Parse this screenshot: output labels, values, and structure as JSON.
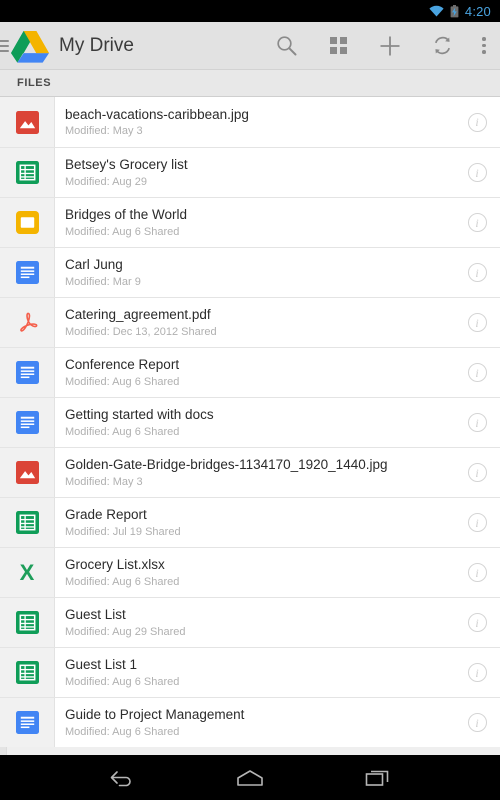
{
  "status_bar": {
    "time": "4:20",
    "wifi_icon": "wifi-icon",
    "battery_icon": "battery-charging-icon",
    "accent_color": "#4aa3df"
  },
  "action_bar": {
    "title": "My Drive",
    "menu_icon": "hamburger-menu-icon",
    "app_logo": "google-drive-logo",
    "actions": [
      {
        "name": "search-button",
        "icon": "search-icon"
      },
      {
        "name": "grid-view-button",
        "icon": "grid-view-icon"
      },
      {
        "name": "add-button",
        "icon": "plus-icon"
      },
      {
        "name": "sync-button",
        "icon": "sync-refresh-icon"
      },
      {
        "name": "overflow-menu-button",
        "icon": "more-vertical-icon"
      }
    ]
  },
  "tabs": [
    {
      "label": "FILES",
      "selected": true
    }
  ],
  "files": [
    {
      "name": "beach-vacations-caribbean.jpg",
      "meta": "Modified: May 3",
      "icon": "image-file-icon",
      "color": "#db4437"
    },
    {
      "name": "Betsey's Grocery list",
      "meta": "Modified: Aug 29",
      "icon": "google-sheets-icon",
      "color": "#0f9d58"
    },
    {
      "name": "Bridges of the World",
      "meta": "Modified: Aug 6  Shared",
      "icon": "google-slides-icon",
      "color": "#f4b400"
    },
    {
      "name": "Carl Jung",
      "meta": "Modified: Mar 9",
      "icon": "google-docs-icon",
      "color": "#4285f4"
    },
    {
      "name": "Catering_agreement.pdf",
      "meta": "Modified: Dec 13, 2012  Shared",
      "icon": "pdf-file-icon",
      "color": "#f4604c"
    },
    {
      "name": "Conference Report",
      "meta": "Modified: Aug 6  Shared",
      "icon": "google-docs-icon",
      "color": "#4285f4"
    },
    {
      "name": "Getting started with docs",
      "meta": "Modified: Aug 6  Shared",
      "icon": "google-docs-icon",
      "color": "#4285f4"
    },
    {
      "name": "Golden-Gate-Bridge-bridges-1134170_1920_1440.jpg",
      "meta": "Modified: May 3",
      "icon": "image-file-icon",
      "color": "#db4437"
    },
    {
      "name": "Grade Report",
      "meta": "Modified: Jul 19  Shared",
      "icon": "google-sheets-icon",
      "color": "#0f9d58"
    },
    {
      "name": "Grocery List.xlsx",
      "meta": "Modified: Aug 6  Shared",
      "icon": "excel-file-icon",
      "color": "#1e9e5a"
    },
    {
      "name": "Guest List",
      "meta": "Modified: Aug 29  Shared",
      "icon": "google-sheets-icon",
      "color": "#0f9d58"
    },
    {
      "name": "Guest List 1",
      "meta": "Modified: Aug 6  Shared",
      "icon": "google-sheets-icon",
      "color": "#0f9d58"
    },
    {
      "name": "Guide to Project Management",
      "meta": "Modified: Aug 6  Shared",
      "icon": "google-docs-icon",
      "color": "#4285f4"
    }
  ],
  "info_icon_label": "i",
  "nav_bar": {
    "buttons": [
      {
        "name": "nav-back-button",
        "icon": "back-arrow-icon"
      },
      {
        "name": "nav-home-button",
        "icon": "home-icon"
      },
      {
        "name": "nav-recents-button",
        "icon": "recent-apps-icon"
      }
    ]
  }
}
